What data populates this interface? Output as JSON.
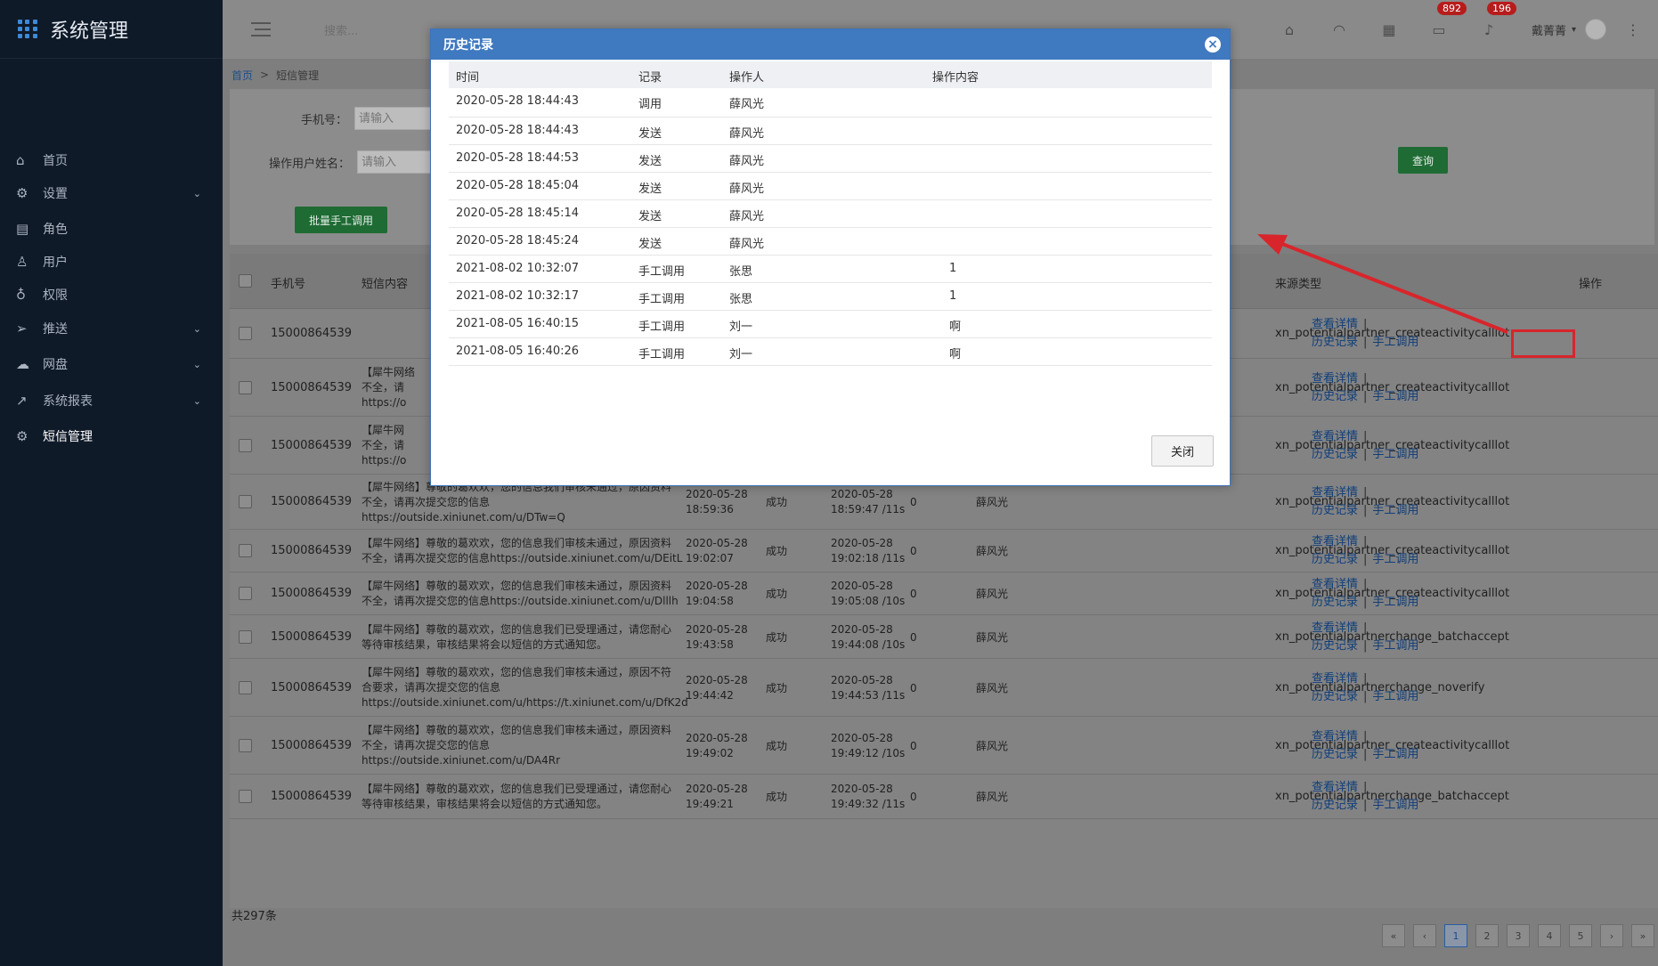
{
  "app": {
    "title": "系统管理"
  },
  "sidebar": {
    "items": [
      {
        "label": "首页",
        "icon": "home-icon",
        "has_children": false
      },
      {
        "label": "设置",
        "icon": "gear-icon",
        "has_children": true
      },
      {
        "label": "角色",
        "icon": "id-card-icon",
        "has_children": false
      },
      {
        "label": "用户",
        "icon": "user-icon",
        "has_children": false
      },
      {
        "label": "权限",
        "icon": "lock-icon",
        "has_children": false
      },
      {
        "label": "推送",
        "icon": "send-icon",
        "has_children": true
      },
      {
        "label": "网盘",
        "icon": "cloud-icon",
        "has_children": true
      },
      {
        "label": "系统报表",
        "icon": "chart-icon",
        "has_children": true
      },
      {
        "label": "短信管理",
        "icon": "gear-icon",
        "has_children": false,
        "active": true
      }
    ]
  },
  "topbar": {
    "search_placeholder": "搜索...",
    "badge_mail": "892",
    "badge_bell": "196",
    "user_name": "戴菁菁"
  },
  "breadcrumb": {
    "home": "首页",
    "sep": ">",
    "current": "短信管理"
  },
  "filter": {
    "phone_label": "手机号：",
    "phone_placeholder": "请输入",
    "operator_label": "操作用户姓名：",
    "operator_placeholder": "请输入",
    "query_button": "查询",
    "batch_button": "批量手工调用"
  },
  "table": {
    "headers": {
      "phone": "手机号",
      "content": "短信内容",
      "source": "来源类型",
      "actions": "操作"
    },
    "action_labels": {
      "view": "查看详情",
      "history": "历史记录",
      "manual": "手工调用",
      "sep": "|"
    },
    "rows": [
      {
        "phone": "15000864539",
        "content": [
          "",
          "",
          ""
        ],
        "send_time": [
          "",
          ""
        ],
        "status": "",
        "finish_time": [
          "",
          ""
        ],
        "retry": "",
        "operator": "",
        "source": "xn_potentialpartner_createactivitycalllot"
      },
      {
        "phone": "15000864539",
        "content": [
          "【犀牛网络",
          "不全，请",
          "https://o"
        ],
        "send_time": [
          "",
          ""
        ],
        "status": "",
        "finish_time": [
          "",
          ""
        ],
        "retry": "",
        "operator": "",
        "source": "xn_potentialpartner_createactivitycalllot"
      },
      {
        "phone": "15000864539",
        "content": [
          "【犀牛网",
          "不全，请",
          "https://o"
        ],
        "send_time": [
          "",
          ""
        ],
        "status": "",
        "finish_time": [
          "",
          ""
        ],
        "retry": "",
        "operator": "",
        "source": "xn_potentialpartner_createactivitycalllot"
      },
      {
        "phone": "15000864539",
        "content": [
          "【犀牛网络】尊敬的葛欢欢，您的信息我们审核未通过，原因资料",
          "不全，请再次提交您的信息",
          "https://outside.xiniunet.com/u/DTw=Q"
        ],
        "send_time": [
          "2020-05-28",
          "18:59:36"
        ],
        "status": "成功",
        "finish_time": [
          "2020-05-28",
          "18:59:47 /11s"
        ],
        "retry": "0",
        "operator": "薛风光",
        "source": "xn_potentialpartner_createactivitycalllot"
      },
      {
        "phone": "15000864539",
        "content": [
          "【犀牛网络】尊敬的葛欢欢，您的信息我们审核未通过，原因资料",
          "不全，请再次提交您的信息https://outside.xiniunet.com/u/DEitL",
          ""
        ],
        "send_time": [
          "2020-05-28",
          "19:02:07"
        ],
        "status": "成功",
        "finish_time": [
          "2020-05-28",
          "19:02:18 /11s"
        ],
        "retry": "0",
        "operator": "薛风光",
        "source": "xn_potentialpartner_createactivitycalllot"
      },
      {
        "phone": "15000864539",
        "content": [
          "【犀牛网络】尊敬的葛欢欢，您的信息我们审核未通过，原因资料",
          "不全，请再次提交您的信息https://outside.xiniunet.com/u/Dlllh",
          ""
        ],
        "send_time": [
          "2020-05-28",
          "19:04:58"
        ],
        "status": "成功",
        "finish_time": [
          "2020-05-28",
          "19:05:08 /10s"
        ],
        "retry": "0",
        "operator": "薛风光",
        "source": "xn_potentialpartner_createactivitycalllot"
      },
      {
        "phone": "15000864539",
        "content": [
          "【犀牛网络】尊敬的葛欢欢，您的信息我们已受理通过，请您耐心",
          "等待审核结果，审核结果将会以短信的方式通知您。",
          ""
        ],
        "send_time": [
          "2020-05-28",
          "19:43:58"
        ],
        "status": "成功",
        "finish_time": [
          "2020-05-28",
          "19:44:08 /10s"
        ],
        "retry": "0",
        "operator": "薛风光",
        "source": "xn_potentialpartnerchange_batchaccept"
      },
      {
        "phone": "15000864539",
        "content": [
          "【犀牛网络】尊敬的葛欢欢，您的信息我们审核未通过，原因不符",
          "合要求，请再次提交您的信息",
          "https://outside.xiniunet.com/u/https://t.xiniunet.com/u/DfK2d"
        ],
        "send_time": [
          "2020-05-28",
          "19:44:42"
        ],
        "status": "成功",
        "finish_time": [
          "2020-05-28",
          "19:44:53 /11s"
        ],
        "retry": "0",
        "operator": "薛风光",
        "source": "xn_potentialpartnerchange_noverify"
      },
      {
        "phone": "15000864539",
        "content": [
          "【犀牛网络】尊敬的葛欢欢，您的信息我们审核未通过，原因资料",
          "不全，请再次提交您的信息",
          "https://outside.xiniunet.com/u/DA4Rr"
        ],
        "send_time": [
          "2020-05-28",
          "19:49:02"
        ],
        "status": "成功",
        "finish_time": [
          "2020-05-28",
          "19:49:12 /10s"
        ],
        "retry": "0",
        "operator": "薛风光",
        "source": "xn_potentialpartner_createactivitycalllot"
      },
      {
        "phone": "15000864539",
        "content": [
          "【犀牛网络】尊敬的葛欢欢，您的信息我们已受理通过，请您耐心",
          "等待审核结果，审核结果将会以短信的方式通知您。",
          ""
        ],
        "send_time": [
          "2020-05-28",
          "19:49:21"
        ],
        "status": "成功",
        "finish_time": [
          "2020-05-28",
          "19:49:32 /11s"
        ],
        "retry": "0",
        "operator": "薛风光",
        "source": "xn_potentialpartnerchange_batchaccept"
      }
    ],
    "total": "共297条"
  },
  "pagination": {
    "first": "«",
    "prev": "‹",
    "pages": [
      "1",
      "2",
      "3",
      "4",
      "5"
    ],
    "current": "1",
    "next": "›",
    "last": "»"
  },
  "modal": {
    "title": "历史记录",
    "close_icon": "×",
    "headers": {
      "time": "时间",
      "record": "记录",
      "operator": "操作人",
      "content": "操作内容"
    },
    "rows": [
      {
        "time": "2020-05-28 18:44:43",
        "record": "调用",
        "operator": "薛风光",
        "content": ""
      },
      {
        "time": "2020-05-28 18:44:43",
        "record": "发送",
        "operator": "薛风光",
        "content": ""
      },
      {
        "time": "2020-05-28 18:44:53",
        "record": "发送",
        "operator": "薛风光",
        "content": ""
      },
      {
        "time": "2020-05-28 18:45:04",
        "record": "发送",
        "operator": "薛风光",
        "content": ""
      },
      {
        "time": "2020-05-28 18:45:14",
        "record": "发送",
        "operator": "薛风光",
        "content": ""
      },
      {
        "time": "2020-05-28 18:45:24",
        "record": "发送",
        "operator": "薛风光",
        "content": ""
      },
      {
        "time": "2021-08-02 10:32:07",
        "record": "手工调用",
        "operator": "张思",
        "content": "1"
      },
      {
        "time": "2021-08-02 10:32:17",
        "record": "手工调用",
        "operator": "张思",
        "content": "1"
      },
      {
        "time": "2021-08-05 16:40:15",
        "record": "手工调用",
        "operator": "刘一",
        "content": "啊"
      },
      {
        "time": "2021-08-05 16:40:26",
        "record": "手工调用",
        "operator": "刘一",
        "content": "啊"
      }
    ],
    "close_button": "关闭"
  },
  "colors": {
    "sidebar": "#0f1a29",
    "modal_header": "#3f79c0",
    "highlight": "#d8252b",
    "primary_green": "#1f6b34"
  }
}
